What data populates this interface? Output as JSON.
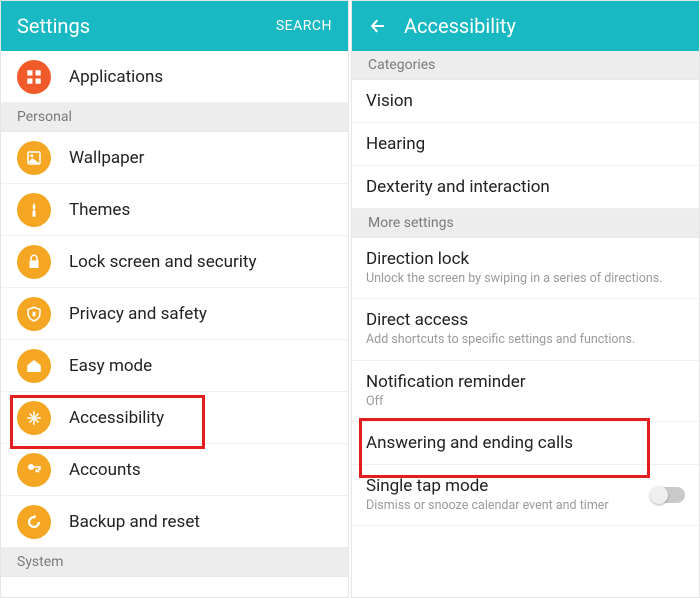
{
  "left": {
    "appbar": {
      "title": "Settings",
      "search": "SEARCH"
    },
    "top_item": {
      "icon": "applications-icon",
      "label": "Applications",
      "color": "icon-red"
    },
    "section_personal": "Personal",
    "personal_items": [
      {
        "icon": "wallpaper-icon",
        "label": "Wallpaper"
      },
      {
        "icon": "themes-icon",
        "label": "Themes"
      },
      {
        "icon": "lock-icon",
        "label": "Lock screen and security"
      },
      {
        "icon": "privacy-icon",
        "label": "Privacy and safety"
      },
      {
        "icon": "easy-mode-icon",
        "label": "Easy mode"
      },
      {
        "icon": "accessibility-icon",
        "label": "Accessibility"
      },
      {
        "icon": "accounts-icon",
        "label": "Accounts"
      },
      {
        "icon": "backup-icon",
        "label": "Backup and reset"
      }
    ],
    "section_system": "System"
  },
  "right": {
    "appbar": {
      "title": "Accessibility"
    },
    "section_categories": "Categories",
    "category_items": [
      {
        "label": "Vision"
      },
      {
        "label": "Hearing"
      },
      {
        "label": "Dexterity and interaction"
      }
    ],
    "section_more": "More settings",
    "more_items": [
      {
        "label": "Direction lock",
        "sub": "Unlock the screen by swiping in a series of directions."
      },
      {
        "label": "Direct access",
        "sub": "Add shortcuts to specific settings and functions."
      },
      {
        "label": "Notification reminder",
        "sub": "Off"
      },
      {
        "label": "Answering and ending calls",
        "sub": ""
      },
      {
        "label": "Single tap mode",
        "sub": "Dismiss or snooze calendar event and timer",
        "toggle": true
      }
    ]
  }
}
